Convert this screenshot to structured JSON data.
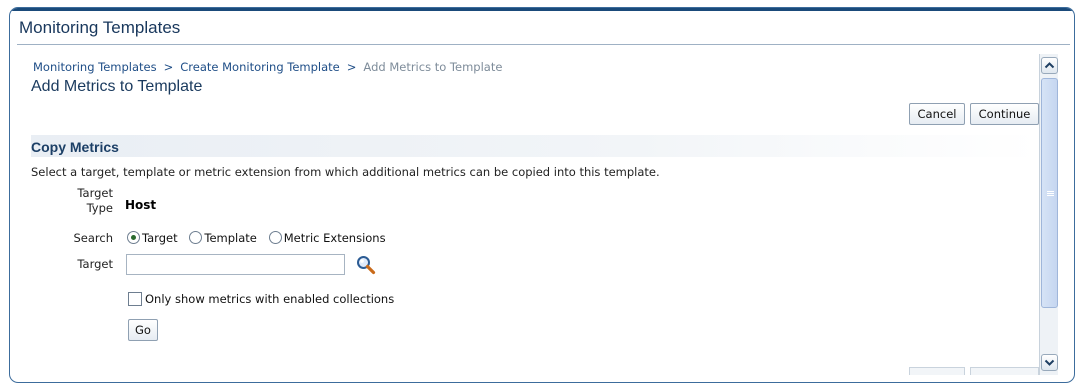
{
  "window": {
    "title": "Monitoring Templates"
  },
  "breadcrumb": {
    "items": [
      {
        "label": "Monitoring Templates"
      },
      {
        "label": "Create Monitoring Template"
      }
    ],
    "separator": ">",
    "current": "Add Metrics to Template"
  },
  "page": {
    "title": "Add Metrics to Template"
  },
  "actions": {
    "cancel_label": "Cancel",
    "continue_label": "Continue"
  },
  "copy_metrics": {
    "title": "Copy Metrics",
    "description": "Select a target, template or metric extension from which additional metrics can be copied into this template.",
    "target_type_label": "Target Type",
    "target_type_value": "Host",
    "search_label": "Search",
    "search_options": [
      {
        "label": "Target",
        "selected": true
      },
      {
        "label": "Template",
        "selected": false
      },
      {
        "label": "Metric Extensions",
        "selected": false
      }
    ],
    "target_label": "Target",
    "target_value": "",
    "only_enabled_label": "Only show metrics with enabled collections",
    "only_enabled_checked": false,
    "go_label": "Go"
  },
  "icons": {
    "search": "magnifier-icon",
    "scroll_up": "chevron-up-icon",
    "scroll_down": "chevron-down-icon"
  },
  "colors": {
    "title_text": "#18375c",
    "link": "#1f4e87",
    "window_border": "#3c6c9c",
    "scroll_thumb": "#c5d6f0"
  }
}
